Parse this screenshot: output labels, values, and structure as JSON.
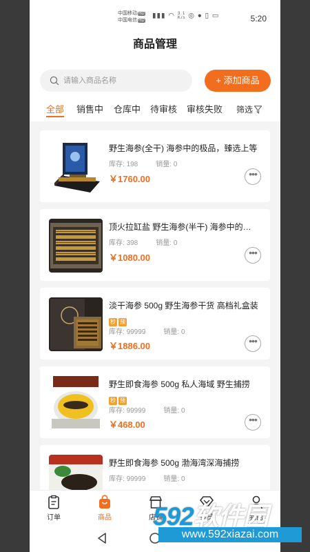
{
  "status_bar": {
    "carrier1": "中国移动",
    "carrier2": "中国电信",
    "hd": "HD",
    "speed_value": "3.1",
    "speed_unit": "K/s",
    "time": "5:20"
  },
  "header": {
    "title": "商品管理"
  },
  "search": {
    "placeholder": "请输入商品名称"
  },
  "add_button": {
    "label": "+ 添加商品"
  },
  "tabs": [
    {
      "label": "全部",
      "active": true
    },
    {
      "label": "销售中"
    },
    {
      "label": "仓库中"
    },
    {
      "label": "待审核"
    },
    {
      "label": "审核失败"
    }
  ],
  "filter": {
    "label": "筛选"
  },
  "products": [
    {
      "name": "野生海参(全干) 海参中的极品，臻选上等",
      "badges": [],
      "stock_label": "库存:",
      "stock": "198",
      "sales_label": "销量:",
      "sales": "0",
      "price": "￥1760.00"
    },
    {
      "name": "顶火拉缸盐 野生海参(半干) 海参中的精品",
      "badges": [],
      "stock_label": "库存:",
      "stock": "398",
      "sales_label": "销量:",
      "sales": "0",
      "price": "￥1080.00"
    },
    {
      "name": "淡干海参 500g 野生海参干货 高档礼盒装",
      "badges": [
        "秒",
        "预"
      ],
      "stock_label": "库存:",
      "stock": "99999",
      "sales_label": "销量:",
      "sales": "0",
      "price": "￥1886.00"
    },
    {
      "name": "野生即食海参 500g 私人海域 野生捕捞",
      "badges": [
        "秒",
        "预"
      ],
      "stock_label": "库存:",
      "stock": "99999",
      "sales_label": "销量:",
      "sales": "0",
      "price": "￥468.00"
    },
    {
      "name": "野生即食海参 500g 渤海湾深海捕捞",
      "badges": [],
      "stock_label": "库存:",
      "stock": "99999",
      "sales_label": "销量:",
      "sales": "0",
      "price": ""
    }
  ],
  "bottom_nav": [
    {
      "label": "订单",
      "icon": "order-icon"
    },
    {
      "label": "商品",
      "icon": "bag-icon",
      "active": true
    },
    {
      "label": "店铺",
      "icon": "shop-icon"
    },
    {
      "label": "会员",
      "icon": "vip-icon"
    },
    {
      "label": "我的",
      "icon": "user-icon"
    }
  ],
  "watermark": {
    "brand_num": "592",
    "brand_text": "软件园",
    "url": "www.592xiazai.com"
  },
  "colors": {
    "accent": "#f26e1e",
    "badge": "#f0a030",
    "watermark_blue": "#1e9ad6"
  }
}
